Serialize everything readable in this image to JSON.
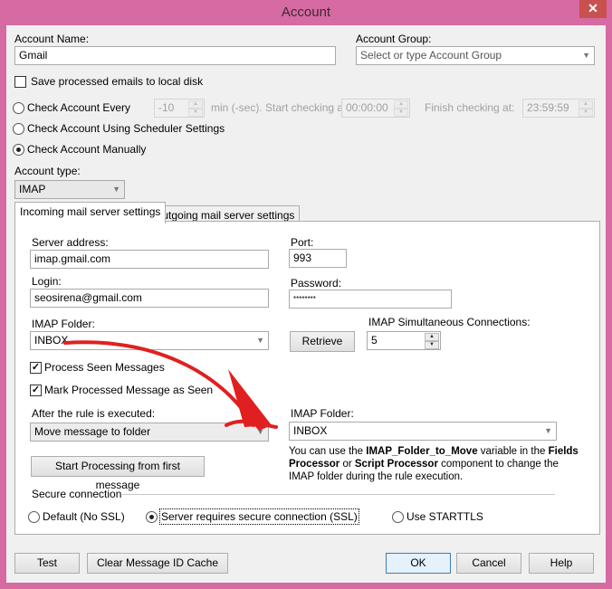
{
  "window": {
    "title": "Account",
    "close_label": "✕"
  },
  "general": {
    "account_name_label": "Account Name:",
    "account_name_value": "Gmail",
    "account_group_label": "Account Group:",
    "account_group_placeholder": "Select or type Account Group",
    "save_local_label": "Save processed emails to local disk",
    "save_local_checked": false,
    "check_every_label": "Check Account Every",
    "check_every_value": "-10",
    "check_every_unit": "min (-sec). Start checking at:",
    "start_time": "00:00:00",
    "finish_label": "Finish checking at:",
    "finish_time": "23:59:59",
    "scheduler_label": "Check Account Using Scheduler Settings",
    "manual_label": "Check Account Manually",
    "selected_check_mode": "manual",
    "account_type_label": "Account type:",
    "account_type_value": "IMAP"
  },
  "tabs": [
    {
      "label": "Incoming mail server settings",
      "active": true
    },
    {
      "label": "Outgoing mail server settings",
      "active": false
    }
  ],
  "incoming": {
    "server_label": "Server address:",
    "server_value": "imap.gmail.com",
    "port_label": "Port:",
    "port_value": "993",
    "login_label": "Login:",
    "login_value": "seosirena@gmail.com",
    "password_label": "Password:",
    "password_value": "********",
    "imap_folder_label": "IMAP Folder:",
    "imap_folder_value": "INBOX",
    "retrieve_label": "Retrieve",
    "connections_label": "IMAP Simultaneous Connections:",
    "connections_value": "5",
    "process_seen_label": "Process Seen Messages",
    "process_seen_checked": true,
    "mark_seen_label": "Mark Processed Message as Seen",
    "mark_seen_checked": true,
    "after_rule_label": "After the rule is executed:",
    "after_rule_value": "Move message to folder",
    "move_folder_label": "IMAP Folder:",
    "move_folder_value": "INBOX",
    "note_parts": {
      "p1": "You can use the ",
      "b1": "IMAP_Folder_to_Move",
      "p2": " variable in the ",
      "b2": "Fields Processor",
      "p3": " or ",
      "b3": "Script Processor",
      "p4": " component to change the IMAP folder during the rule execution."
    },
    "start_processing_label": "Start Processing from first message",
    "secure_label": "Secure connection",
    "ssl_options": [
      {
        "label": "Default (No SSL)",
        "selected": false
      },
      {
        "label": "Server requires secure connection (SSL)",
        "selected": true
      },
      {
        "label": "Use STARTTLS",
        "selected": false
      }
    ]
  },
  "footer": {
    "test_label": "Test",
    "clear_cache_label": "Clear Message ID Cache",
    "ok_label": "OK",
    "cancel_label": "Cancel",
    "help_label": "Help"
  },
  "annotation": {
    "arrow_color": "#e02020"
  }
}
